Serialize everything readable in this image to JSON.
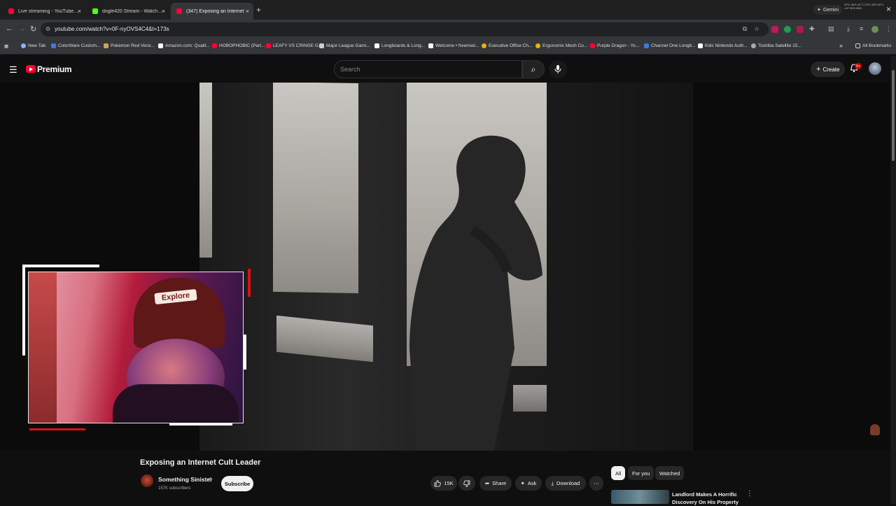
{
  "browser": {
    "tabs": [
      {
        "title": "Live streaming - YouTube Studio",
        "favicon_color": "#ff0033",
        "active": false
      },
      {
        "title": "dogle420 Stream - Watch Live",
        "favicon_color": "#53fc18",
        "active": false
      },
      {
        "title": "(347) Exposing an Internet",
        "favicon_color": "#ff0033",
        "active": true
      }
    ],
    "close_glyph": "×",
    "new_tab_glyph": "+",
    "gemini_label": "Gemini",
    "sysinfo": "GPU 36% 42°C  CPU 38% 63°C  LAT 80% 86%",
    "url": "youtube.com/watch?v=0F-nyOVS4C4&t=173s",
    "bookmarks": [
      {
        "label": "New Tab",
        "color": "#8ab4f8"
      },
      {
        "label": "ColorWare Custom...",
        "color": "#3d7bd9"
      },
      {
        "label": "Pokemon Red Versi...",
        "color": "#d0a060"
      },
      {
        "label": "Amazon.com: Qualit...",
        "color": "#ffffff"
      },
      {
        "label": "HOBOPHOBIC (Part...",
        "color": "#ff0033"
      },
      {
        "label": "LEAFY VS CRINGE G...",
        "color": "#ff0033"
      },
      {
        "label": "Major League Gami...",
        "color": "#cccccc"
      },
      {
        "label": "Longboards & Long...",
        "color": "#ffffff"
      },
      {
        "label": "Welcome • freemed...",
        "color": "#ffffff"
      },
      {
        "label": "Executive Office Ch...",
        "color": "#e8b400"
      },
      {
        "label": "Ergonomic Mesh Co...",
        "color": "#e8b400"
      },
      {
        "label": "Purple Dragon - Yo...",
        "color": "#ff0033"
      },
      {
        "label": "Channel One Longb...",
        "color": "#3d7bd9"
      },
      {
        "label": "Kids Nintendo Auth...",
        "color": "#ffffff"
      },
      {
        "label": "Toshiba Satellite 15...",
        "color": "#aaaaaa"
      }
    ],
    "all_bookmarks_label": "All Bookmarks",
    "overflow_glyph": "»"
  },
  "youtube": {
    "logo_text": "Premium",
    "search_placeholder": "Search",
    "create_label": "Create",
    "notification_count": "9+",
    "video": {
      "title": "Exposing an Internet Cult Leader",
      "channel": "Something Sinister",
      "subscribers": "157K subscribers",
      "subscribe_label": "Subscribe",
      "likes": "15K",
      "share_label": "Share",
      "ask_label": "Ask",
      "download_label": "Download"
    },
    "webcam_hat_text": "Explore",
    "chips": [
      "All",
      "For you",
      "Watched"
    ],
    "recommendation_title": "Landlord Makes A Horrific Discovery On His Property"
  },
  "icons": {
    "hamburger": "☰",
    "search": "⌕",
    "mic": "🎙",
    "bell": "🔔",
    "like": "👍",
    "dislike": "👎",
    "share": "➦",
    "ask": "✦",
    "download": "⤓",
    "more": "⋯",
    "kebab": "⋮",
    "verified": "✔"
  }
}
